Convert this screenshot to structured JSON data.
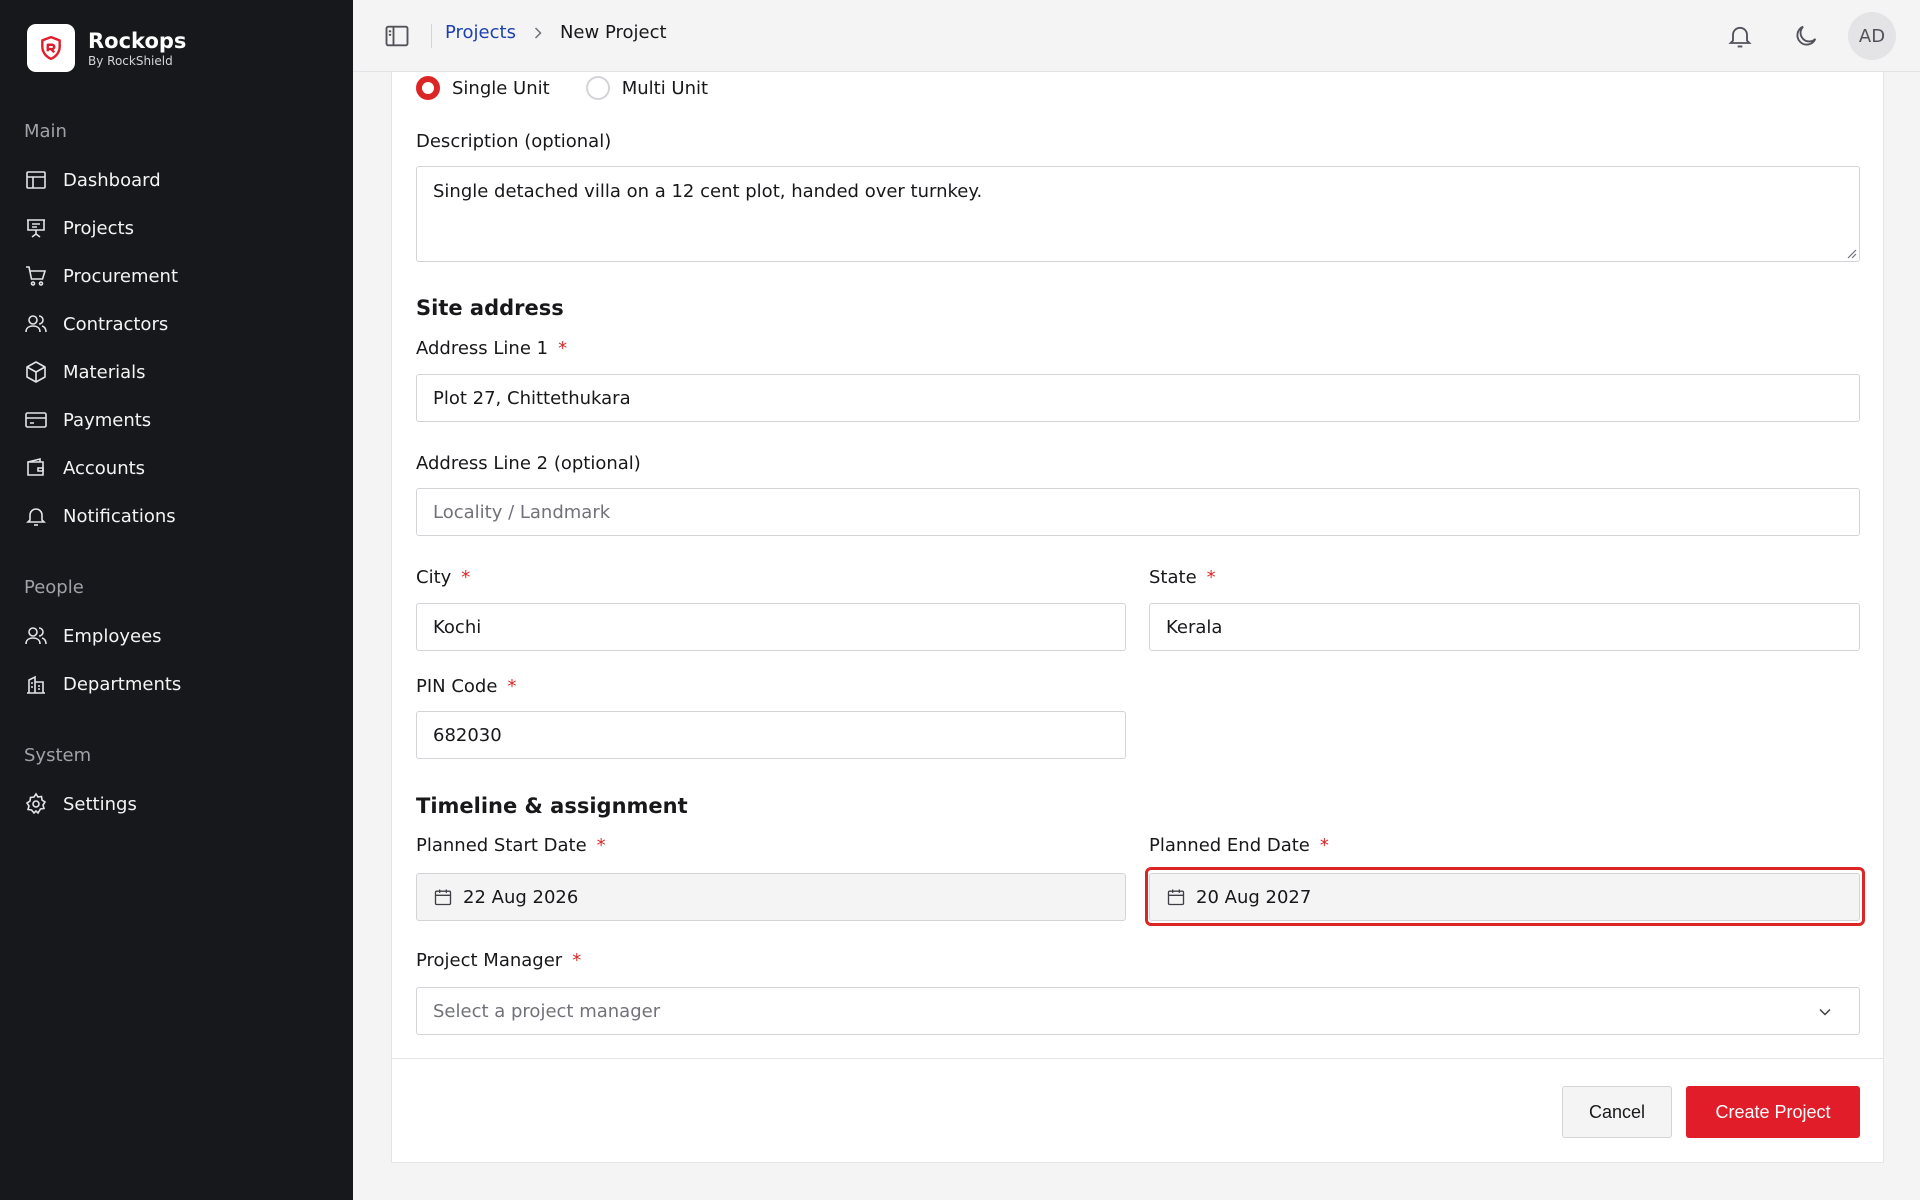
{
  "brand": {
    "name": "Rockops",
    "subtitle": "By RockShield"
  },
  "sidebar": {
    "groups": [
      {
        "label": "Main",
        "items": [
          {
            "label": "Dashboard",
            "icon": "layout-icon"
          },
          {
            "label": "Projects",
            "icon": "presentation-icon"
          },
          {
            "label": "Procurement",
            "icon": "cart-icon"
          },
          {
            "label": "Contractors",
            "icon": "users-icon"
          },
          {
            "label": "Materials",
            "icon": "box-icon"
          },
          {
            "label": "Payments",
            "icon": "card-icon"
          },
          {
            "label": "Accounts",
            "icon": "wallet-icon"
          },
          {
            "label": "Notifications",
            "icon": "bell-icon"
          }
        ]
      },
      {
        "label": "People",
        "items": [
          {
            "label": "Employees",
            "icon": "users-icon"
          },
          {
            "label": "Departments",
            "icon": "building-icon"
          }
        ]
      },
      {
        "label": "System",
        "items": [
          {
            "label": "Settings",
            "icon": "gear-icon"
          }
        ]
      }
    ]
  },
  "header": {
    "breadcrumb": {
      "parent": "Projects",
      "current": "New Project"
    },
    "avatar_initials": "AD"
  },
  "form": {
    "unit_type": {
      "options": [
        "Single Unit",
        "Multi Unit"
      ],
      "selected": "Single Unit"
    },
    "description": {
      "label": "Description (optional)",
      "value": "Single detached villa on a 12 cent plot, handed over turnkey."
    },
    "site_address": {
      "title": "Site address",
      "address1": {
        "label": "Address Line 1",
        "value": "Plot 27, Chittethukara"
      },
      "address2": {
        "label": "Address Line 2 (optional)",
        "placeholder": "Locality / Landmark"
      },
      "city": {
        "label": "City",
        "value": "Kochi"
      },
      "state": {
        "label": "State",
        "value": "Kerala"
      },
      "pin": {
        "label": "PIN Code",
        "value": "682030"
      }
    },
    "timeline": {
      "title": "Timeline & assignment",
      "start": {
        "label": "Planned Start Date",
        "value": "22 Aug 2026"
      },
      "end": {
        "label": "Planned End Date",
        "value": "20 Aug 2027"
      },
      "manager": {
        "label": "Project Manager",
        "placeholder": "Select a project manager"
      }
    },
    "required_marker": "*",
    "actions": {
      "cancel": "Cancel",
      "create": "Create Project"
    }
  },
  "colors": {
    "accent": "#e11d2a",
    "sidebar_bg": "#17181c",
    "link": "#1e40af"
  }
}
